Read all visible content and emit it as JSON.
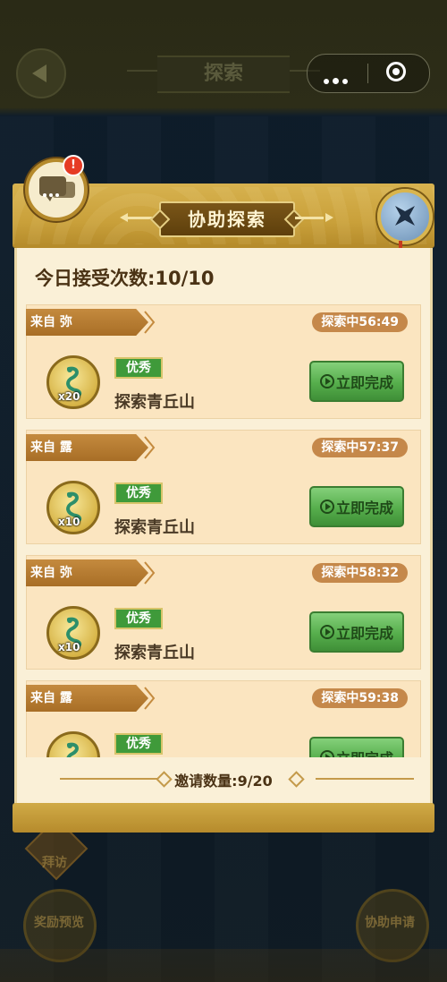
{
  "topbar": {
    "title": "探索"
  },
  "background": {
    "ghost_buttons": [
      {
        "label": "奖励预览"
      },
      {
        "label": "协助申请"
      }
    ],
    "ghost_small_label": "拜访"
  },
  "dialog": {
    "title": "协助探索",
    "alert_badge": "!",
    "accept_count_text": "今日接受次数:10/10",
    "invite_text": "邀请数量:9/20",
    "cards": [
      {
        "from": "来自 弥",
        "timer": "探索中56:49",
        "reward_qty": "x20",
        "grade": "优秀",
        "task": "探索青丘山",
        "action": "立即完成"
      },
      {
        "from": "来自 露",
        "timer": "探索中57:37",
        "reward_qty": "x10",
        "grade": "优秀",
        "task": "探索青丘山",
        "action": "立即完成"
      },
      {
        "from": "来自 弥",
        "timer": "探索中58:32",
        "reward_qty": "x10",
        "grade": "优秀",
        "task": "探索青丘山",
        "action": "立即完成"
      },
      {
        "from": "来自 露",
        "timer": "探索中59:38",
        "reward_qty": "",
        "grade": "优秀",
        "task": "",
        "action": "立即完成"
      }
    ]
  },
  "colors": {
    "accent_gold": "#c9a03a",
    "panel_bg": "#faf0d7",
    "card_bg": "#fbe5c0",
    "button_green": "#56ae4c",
    "tag_brown": "#a86e26"
  },
  "icons": [
    "back-arrow-icon",
    "more-dots-icon",
    "target-icon",
    "chat-icon",
    "close-icon",
    "play-icon",
    "coin-snake-icon"
  ]
}
